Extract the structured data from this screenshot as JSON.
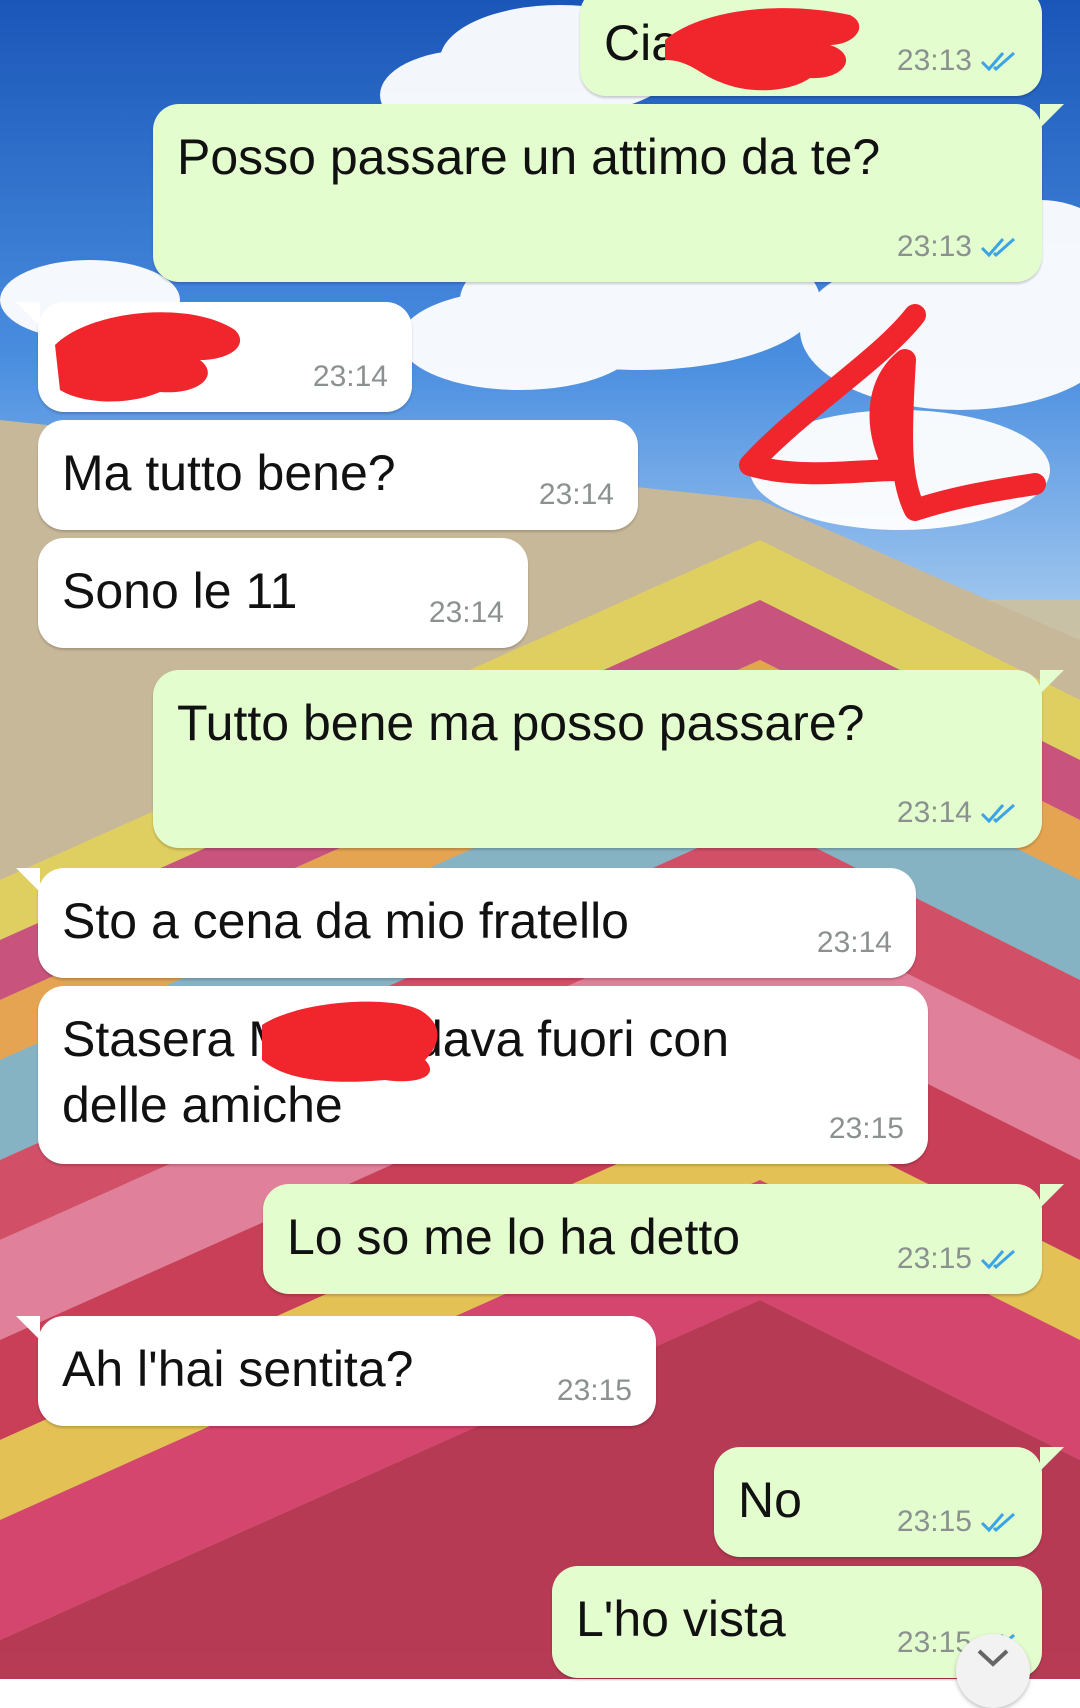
{
  "chat": {
    "messages": [
      {
        "id": "m1",
        "direction": "out",
        "text": "Cia",
        "time": "23:13",
        "status": "read"
      },
      {
        "id": "m2",
        "direction": "out",
        "text": "Posso passare un attimo da te?",
        "time": "23:13",
        "status": "read"
      },
      {
        "id": "m3",
        "direction": "in",
        "text": "",
        "time": "23:14"
      },
      {
        "id": "m4",
        "direction": "in",
        "text": "Ma tutto bene?",
        "time": "23:14"
      },
      {
        "id": "m5",
        "direction": "in",
        "text": "Sono le 11",
        "time": "23:14"
      },
      {
        "id": "m6",
        "direction": "out",
        "text": "Tutto bene ma posso passare?",
        "time": "23:14",
        "status": "read"
      },
      {
        "id": "m7",
        "direction": "in",
        "text": "Sto a cena da mio fratello",
        "time": "23:14"
      },
      {
        "id": "m8",
        "direction": "in",
        "text": "Stasera M  a andava fuori con\ndelle amiche",
        "time": "23:15"
      },
      {
        "id": "m9",
        "direction": "out",
        "text": "Lo so me lo ha detto",
        "time": "23:15",
        "status": "read"
      },
      {
        "id": "m10",
        "direction": "in",
        "text": "Ah l'hai sentita?",
        "time": "23:15"
      },
      {
        "id": "m11",
        "direction": "out",
        "text": "No",
        "time": "23:15",
        "status": "read"
      },
      {
        "id": "m12",
        "direction": "out",
        "text": "L'ho vista",
        "time": "23:15",
        "status": "read"
      }
    ]
  },
  "colors": {
    "outgoing_bubble": "#e4fdcf",
    "incoming_bubble": "#ffffff",
    "read_ticks": "#3aa4e6",
    "redaction_marker": "#f1262d"
  },
  "icons": [
    "double-check-icon",
    "scroll-down-icon"
  ]
}
